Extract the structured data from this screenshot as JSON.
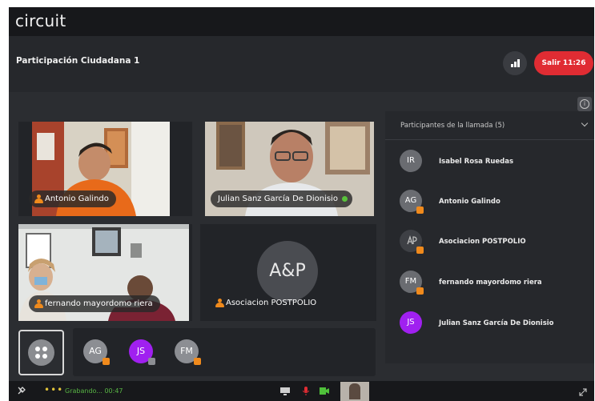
{
  "app": {
    "logo": "circuit"
  },
  "call": {
    "title": "Participación Ciudadana 1",
    "leave_label": "Salir 11:26",
    "signal_icon": "signal-bars-icon",
    "info_icon": "info-icon"
  },
  "tiles": [
    {
      "name": "Antonio Galindo",
      "has_video": true
    },
    {
      "name": "Julian Sanz García De Dionisio",
      "has_video": true,
      "active": true
    },
    {
      "name": "fernando mayordomo riera",
      "has_video": true
    },
    {
      "name": "Asociacion POSTPOLIO",
      "has_video": false,
      "initials": "A&P"
    }
  ],
  "strip": {
    "avatars": [
      {
        "initials": "AG",
        "color": "#8c8e93",
        "badge": "person"
      },
      {
        "initials": "JS",
        "color": "#a020f0",
        "badge": "screen"
      },
      {
        "initials": "FM",
        "color": "#8c8e93",
        "badge": "person"
      }
    ]
  },
  "sidebar": {
    "title": "Participantes de la llamada (5)",
    "participants": [
      {
        "initials": "IR",
        "name": "Isabel Rosa Ruedas",
        "color": "#6a6c71",
        "badge": false
      },
      {
        "initials": "AG",
        "name": "Antonio Galindo",
        "color": "#6a6c71",
        "badge": true
      },
      {
        "initials": "",
        "name": "Asociacion POSTPOLIO",
        "color": "#3e4045",
        "badge": true
      },
      {
        "initials": "FM",
        "name": "fernando mayordomo riera",
        "color": "#6a6c71",
        "badge": true
      },
      {
        "initials": "JS",
        "name": "Julian Sanz García De Dionisio",
        "color": "#a020f0",
        "badge": false
      }
    ]
  },
  "status": {
    "recording": "Grabando... 00:47"
  },
  "colors": {
    "accent_red": "#e02c33",
    "recording_green": "#58b544",
    "presenter_purple": "#a020f0",
    "badge_orange": "#f08a1c"
  }
}
